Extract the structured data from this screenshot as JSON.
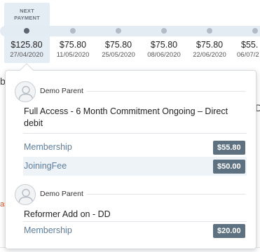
{
  "timeline": {
    "next_payment_label_line1": "NEXT",
    "next_payment_label_line2": "PAYMENT",
    "payments": [
      {
        "amount": "$125.80",
        "date": "27/04/2020"
      },
      {
        "amount": "$75.80",
        "date": "11/05/2020"
      },
      {
        "amount": "$75.80",
        "date": "25/05/2020"
      },
      {
        "amount": "$75.80",
        "date": "08/06/2020"
      },
      {
        "amount": "$75.80",
        "date": "22/06/2020"
      },
      {
        "amount": "$55.",
        "date": "06/07/2"
      }
    ]
  },
  "background": {
    "frag_left": "b",
    "frag_right": "D",
    "frag_red": "as"
  },
  "popover": {
    "groups": [
      {
        "parent_name": "Demo Parent",
        "plan_title": "Full Access - 6 Month Commitment Ongoing – Direct debit",
        "items": [
          {
            "name": "Membership",
            "price": "$55.80"
          },
          {
            "name": "JoiningFee",
            "price": "$50.00"
          }
        ]
      },
      {
        "parent_name": "Demo Parent",
        "plan_title": "Reformer Add on - DD",
        "items": [
          {
            "name": "Membership",
            "price": "$20.00"
          }
        ]
      }
    ]
  },
  "colors": {
    "badge": "#5e7181",
    "link_text": "#5b7da0",
    "track": "#e3ebf3"
  }
}
